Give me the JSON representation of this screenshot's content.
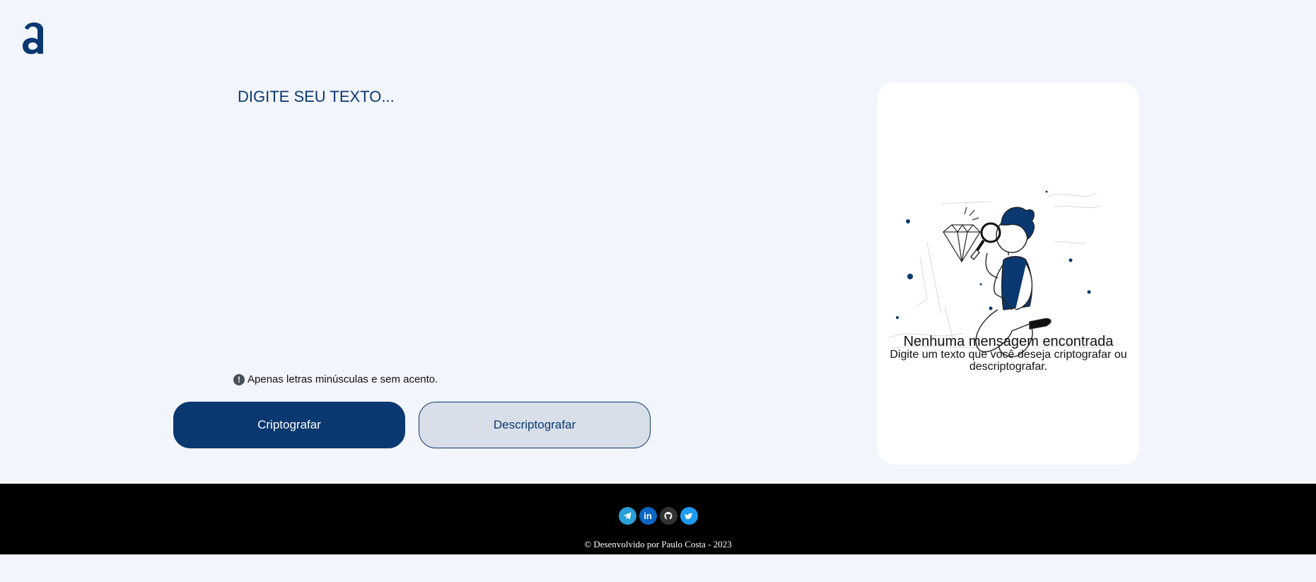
{
  "logo": {
    "icon": "alura-a-logo-icon",
    "color": "#0a3871"
  },
  "input": {
    "placeholder": "DIGITE SEU TEXTO...",
    "value": ""
  },
  "hint": {
    "icon": "exclamation-icon",
    "text": "Apenas letras minúsculas e sem acento."
  },
  "buttons": {
    "encrypt_label": "Criptografar",
    "decrypt_label": "Descriptografar"
  },
  "output": {
    "illustration": "person-with-magnifying-glass-illustration",
    "title": "Nenhuma mensagem encontrada",
    "subtitle": "Digite um texto que você deseja criptografar ou descriptografar."
  },
  "footer": {
    "socials": [
      {
        "name": "telegram-icon",
        "color": "#2a9fd8"
      },
      {
        "name": "linkedin-icon",
        "color": "#0a66c2"
      },
      {
        "name": "github-icon",
        "color": "#333333"
      },
      {
        "name": "twitter-icon",
        "color": "#1d9bf0"
      }
    ],
    "copyright": "© Desenvolvido por Paulo Costa - 2023"
  },
  "colors": {
    "accent": "#0a3871",
    "background": "#f3f5fc",
    "footer": "#000000"
  }
}
